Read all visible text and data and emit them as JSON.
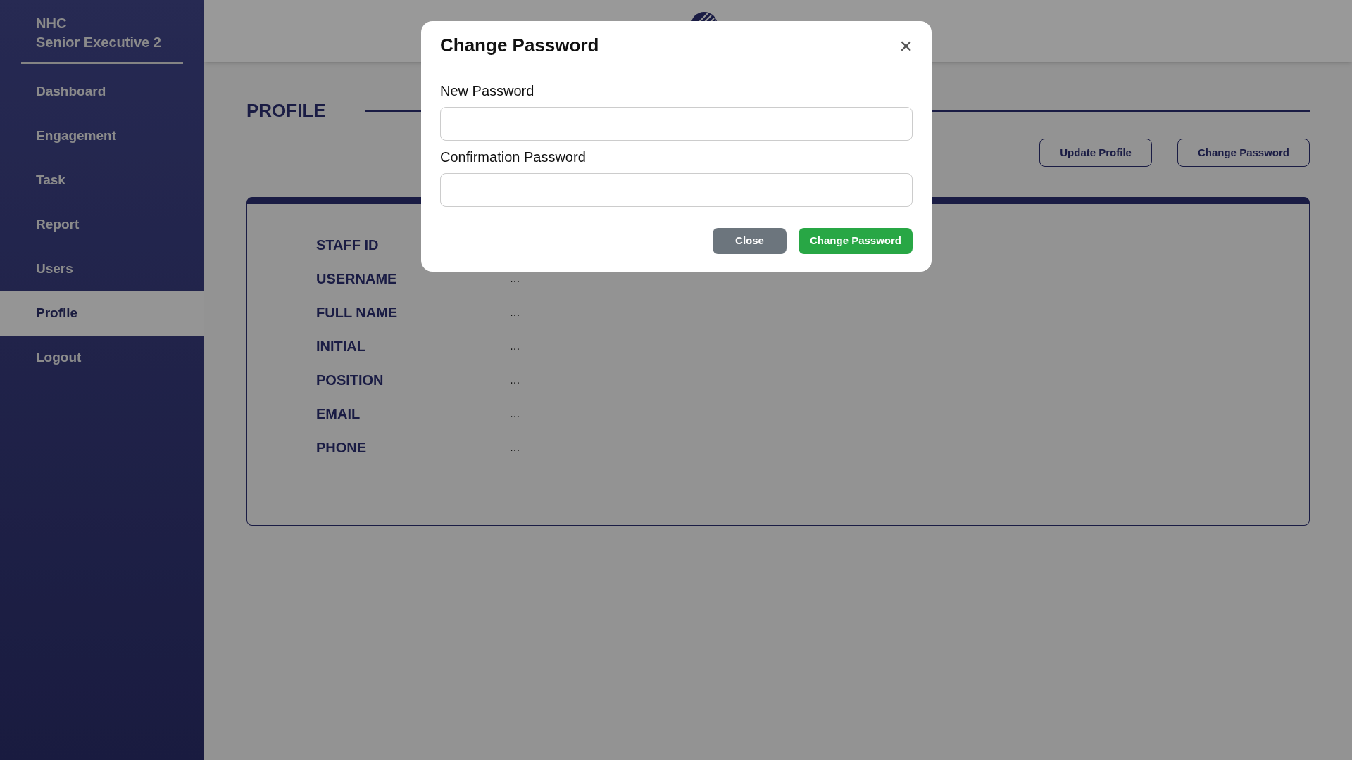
{
  "sidebar": {
    "org": "NHC",
    "role": "Senior Executive 2",
    "items": [
      {
        "label": "Dashboard",
        "selected": false
      },
      {
        "label": "Engagement",
        "selected": false
      },
      {
        "label": "Task",
        "selected": false
      },
      {
        "label": "Report",
        "selected": false
      },
      {
        "label": "Users",
        "selected": false
      },
      {
        "label": "Profile",
        "selected": true
      },
      {
        "label": "Logout",
        "selected": false
      }
    ]
  },
  "page": {
    "title": "PROFILE",
    "actions": [
      "Update Profile",
      "Change Password"
    ]
  },
  "profile_fields": [
    {
      "label": "STAFF ID"
    },
    {
      "label": "USERNAME",
      "value": "..."
    },
    {
      "label": "FULL NAME",
      "value": "..."
    },
    {
      "label": "INITIAL",
      "value": "..."
    },
    {
      "label": "POSITION",
      "value": "..."
    },
    {
      "label": "EMAIL",
      "value": "..."
    },
    {
      "label": "PHONE",
      "value": "..."
    }
  ],
  "modal": {
    "title": "Change Password",
    "close": "×",
    "fields": [
      {
        "label": "New Password"
      },
      {
        "label": "Confirmation Password"
      }
    ],
    "buttons": [
      {
        "label": "Close",
        "kind": "secondary"
      },
      {
        "label": "Change Password",
        "kind": "primary"
      }
    ]
  }
}
